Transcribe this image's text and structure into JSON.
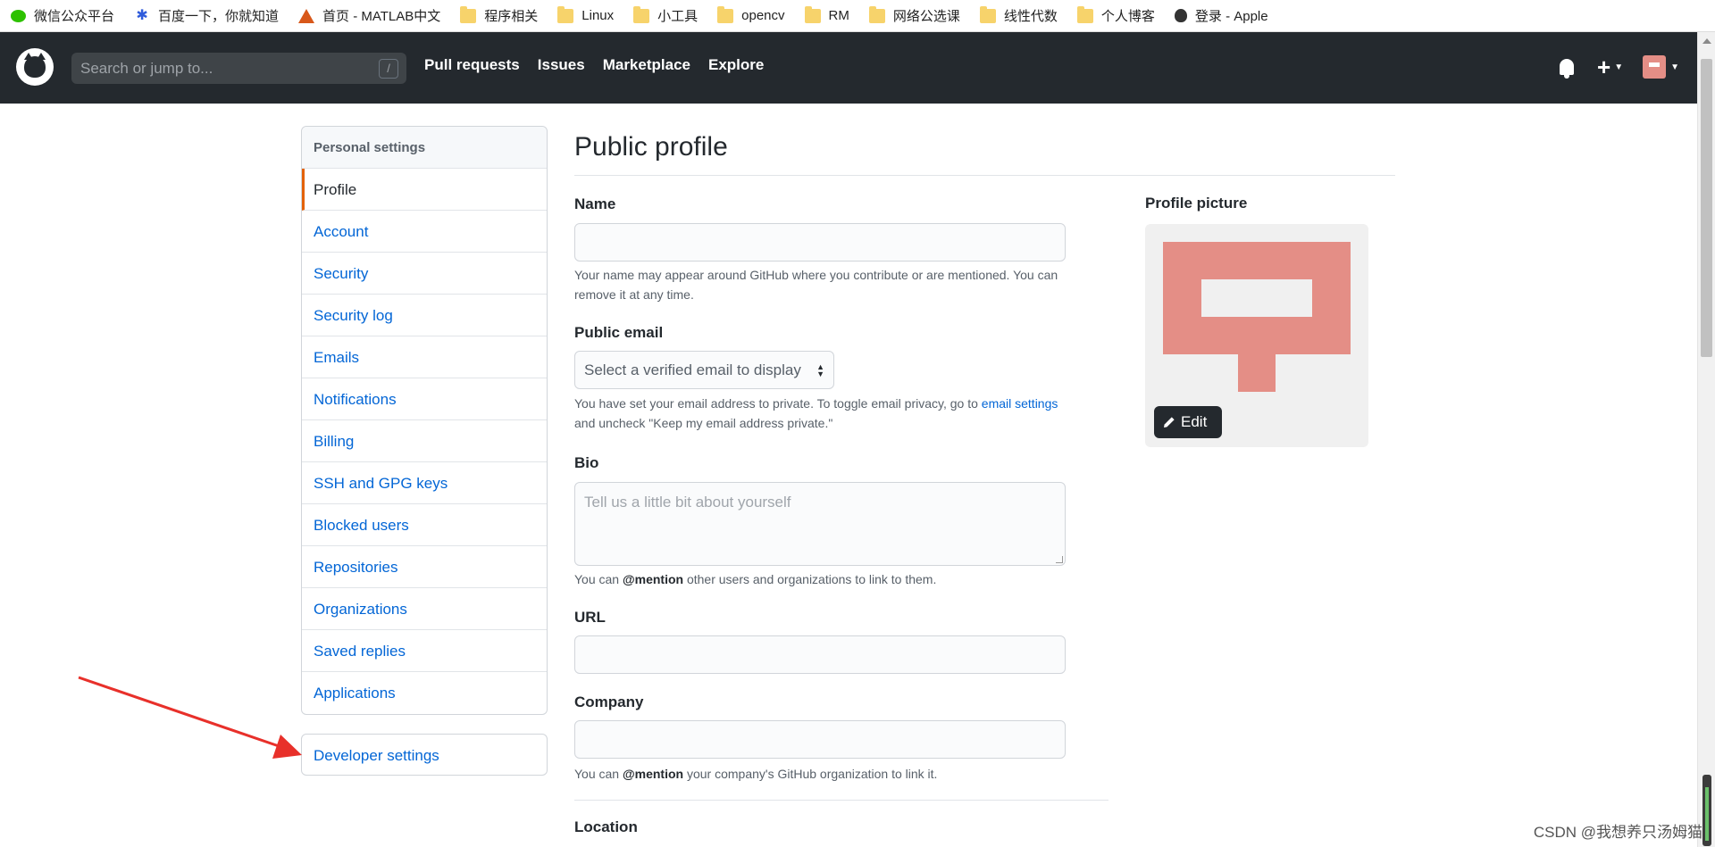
{
  "bookmarks": [
    {
      "icon": "wechat-icon",
      "label": "微信公众平台"
    },
    {
      "icon": "baidu-icon",
      "label": "百度一下，你就知道"
    },
    {
      "icon": "matlab-icon",
      "label": "首页 - MATLAB中文"
    },
    {
      "icon": "folder-icon",
      "label": "程序相关"
    },
    {
      "icon": "folder-icon",
      "label": "Linux"
    },
    {
      "icon": "folder-icon",
      "label": "小工具"
    },
    {
      "icon": "folder-icon",
      "label": "opencv"
    },
    {
      "icon": "folder-icon",
      "label": "RM"
    },
    {
      "icon": "folder-icon",
      "label": "网络公选课"
    },
    {
      "icon": "folder-icon",
      "label": "线性代数"
    },
    {
      "icon": "folder-icon",
      "label": "个人博客"
    },
    {
      "icon": "apple-icon",
      "label": "登录 - Apple"
    }
  ],
  "header": {
    "search_placeholder": "Search or jump to...",
    "search_shortcut": "/",
    "nav": [
      "Pull requests",
      "Issues",
      "Marketplace",
      "Explore"
    ],
    "plus": "+"
  },
  "sidebar": {
    "heading": "Personal settings",
    "items": [
      {
        "label": "Profile",
        "selected": true
      },
      {
        "label": "Account"
      },
      {
        "label": "Security"
      },
      {
        "label": "Security log"
      },
      {
        "label": "Emails"
      },
      {
        "label": "Notifications"
      },
      {
        "label": "Billing"
      },
      {
        "label": "SSH and GPG keys"
      },
      {
        "label": "Blocked users"
      },
      {
        "label": "Repositories"
      },
      {
        "label": "Organizations"
      },
      {
        "label": "Saved replies"
      },
      {
        "label": "Applications"
      }
    ],
    "developer_settings": "Developer settings"
  },
  "profile": {
    "title": "Public profile",
    "name_label": "Name",
    "name_note_1": "Your name may appear around GitHub where you contribute or are mentioned. You can",
    "name_note_2": "remove it at any time.",
    "email_label": "Public email",
    "email_select": "Select a verified email to display",
    "email_note_1": "You have set your email address to private. To toggle email privacy, go to",
    "email_note_link": "email settings",
    "email_note_2": "and uncheck \"Keep my email address private.\"",
    "bio_label": "Bio",
    "bio_placeholder": "Tell us a little bit about yourself",
    "bio_note_pre": "You can",
    "bio_note_mention": "@mention",
    "bio_note_post": "other users and organizations to link to them.",
    "url_label": "URL",
    "company_label": "Company",
    "company_note_pre": "You can",
    "company_note_mention": "@mention",
    "company_note_post": "your company's GitHub organization to link it.",
    "location_label": "Location",
    "picture_label": "Profile picture",
    "edit_button": "Edit"
  },
  "colors": {
    "header_bg": "#24292e",
    "link": "#0366d6",
    "selected_border": "#e36209",
    "identicon": "#e48e86",
    "annotation_arrow": "#e8302a"
  },
  "watermark": "CSDN @我想养只汤姆猫"
}
